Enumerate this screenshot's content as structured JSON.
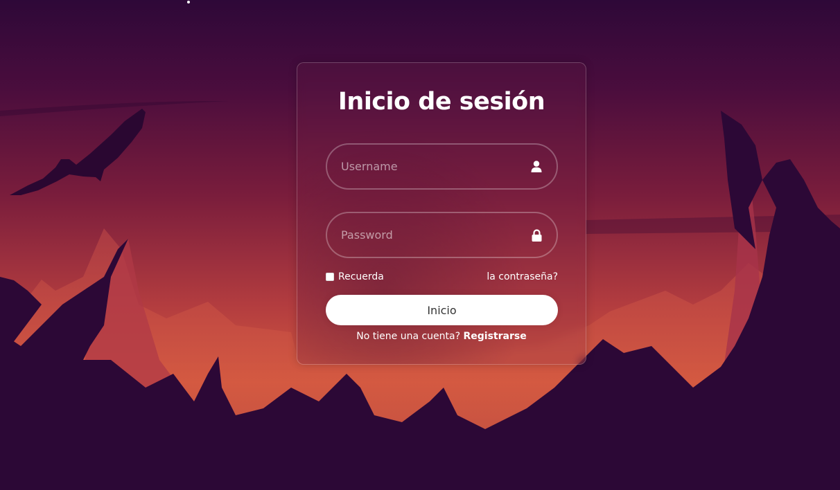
{
  "login": {
    "title": "Inicio de sesión",
    "username": {
      "placeholder": "Username",
      "value": "",
      "icon": "user-icon"
    },
    "password": {
      "placeholder": "Password",
      "value": "",
      "icon": "lock-icon"
    },
    "remember_label": "Recuerda",
    "forgot_label": "la contraseña?",
    "submit_label": "Inicio",
    "register_prompt": "No tiene una cuenta?",
    "register_link": "Registrarse"
  },
  "theme": {
    "sky_top": "#2e0838",
    "glow": "#d4583f",
    "mountain_dark": "#2c0836",
    "button_bg": "#ffffff",
    "button_text": "#333333"
  }
}
